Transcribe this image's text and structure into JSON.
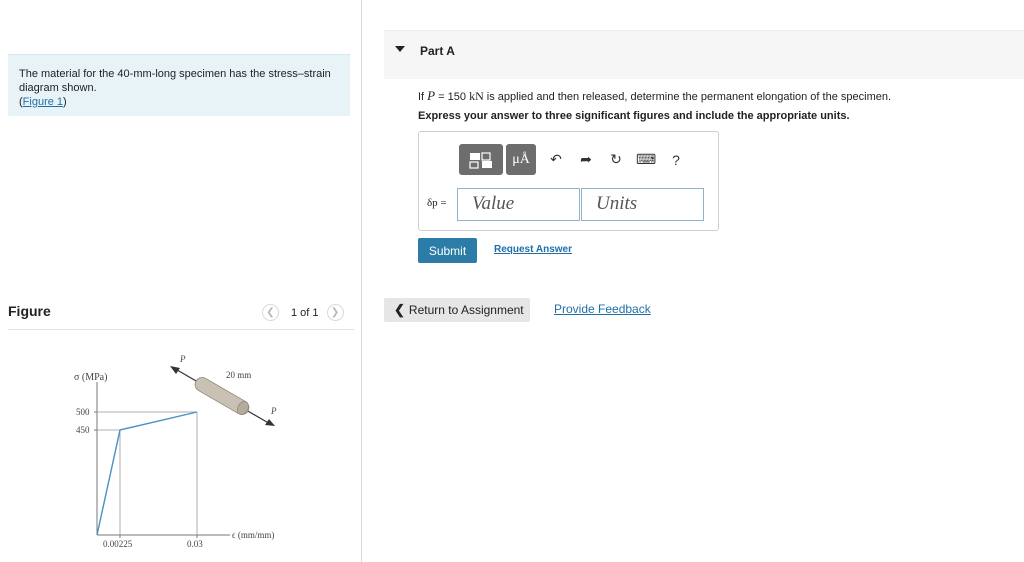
{
  "problem": {
    "text_line1": "The material for the 40-mm-long specimen has the stress–strain",
    "text_line2": "diagram shown.",
    "figure_link": "Figure 1"
  },
  "figure_panel": {
    "title": "Figure",
    "pager": "1 of 1",
    "prev_icon": "chevron-left-icon",
    "next_icon": "chevron-right-icon"
  },
  "diagram": {
    "y_axis_label": "σ (MPa)",
    "x_axis_label": "ϵ (mm/mm)",
    "y_ticks": [
      "500",
      "450"
    ],
    "x_ticks": [
      "0.00225",
      "0.03"
    ],
    "specimen_label": "20 mm",
    "load_label_top": "P",
    "load_label_bottom": "P"
  },
  "part_a": {
    "label": "Part A",
    "question_prefix": "If ",
    "question_var": "P",
    "question_eq": " = 150 ",
    "question_unit": "kN",
    "question_suffix": " is applied and then released, determine the permanent elongation of the specimen.",
    "instruction": "Express your answer to three significant figures and include the appropriate units.",
    "answer_symbol": "δp =",
    "value_placeholder": "Value",
    "units_placeholder": "Units",
    "toolbar": {
      "mu_label": "μÅ",
      "help": "?"
    },
    "submit_label": "Submit",
    "request_answer_label": "Request Answer"
  },
  "footer": {
    "return_label": "Return to Assignment",
    "feedback_label": "Provide Feedback"
  },
  "colors": {
    "link": "#1f6fa8",
    "submit_bg": "#2b7ca6",
    "curve": "#4a90c2",
    "problem_bg": "#e8f3f8"
  }
}
